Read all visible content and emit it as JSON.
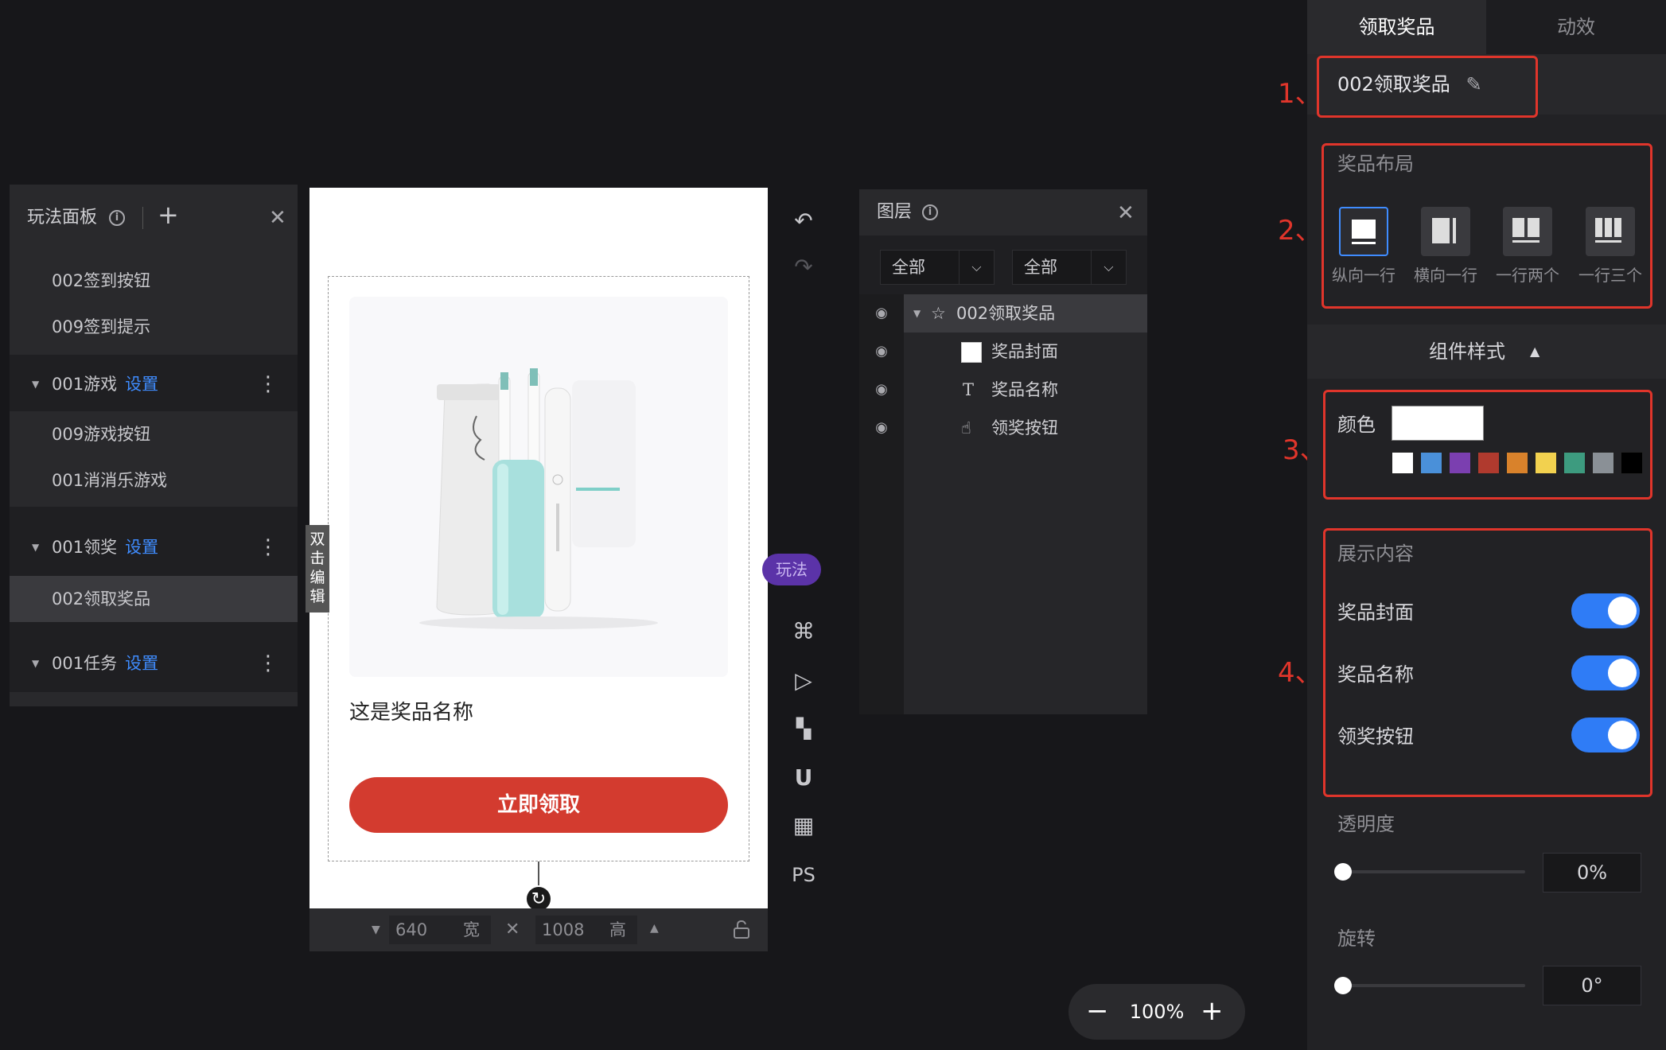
{
  "play_panel": {
    "title": "玩法面板",
    "info_icon": "ⓘ",
    "add_icon": "+",
    "close_icon": "✕",
    "items_top": [
      "002签到按钮",
      "009签到提示"
    ],
    "groups": [
      {
        "name": "001游戏",
        "link": "设置",
        "children": [
          "009游戏按钮",
          "001消消乐游戏"
        ]
      },
      {
        "name": "001领奖",
        "link": "设置",
        "children": [
          "002领取奖品"
        ]
      },
      {
        "name": "001任务",
        "link": "设置",
        "children": []
      }
    ]
  },
  "canvas": {
    "edit_tag": "双击编辑",
    "prize_name": "这是奖品名称",
    "claim_button": "立即领取",
    "width_value": "640",
    "width_label": "宽",
    "height_value": "1008",
    "height_label": "高",
    "times": "✕"
  },
  "tools": {
    "undo": "↶",
    "redo": "↷",
    "play_chip": "玩法",
    "command": "⌘",
    "play": "▷",
    "ruler": "▚",
    "magnet": "U",
    "grid": "▦",
    "ps": "PS"
  },
  "layers": {
    "title": "图层",
    "filter1": "全部",
    "filter2": "全部",
    "rows": [
      {
        "label": "002领取奖品",
        "icon": "star-outline-icon",
        "glyph": "☆",
        "indent": 0
      },
      {
        "label": "奖品封面",
        "icon": "image-thumb-icon",
        "glyph": "▫",
        "indent": 1
      },
      {
        "label": "奖品名称",
        "icon": "text-icon",
        "glyph": "T",
        "indent": 1
      },
      {
        "label": "领奖按钮",
        "icon": "hand-pointer-icon",
        "glyph": "☝",
        "indent": 1
      }
    ]
  },
  "zoom": {
    "minus": "−",
    "value": "100%",
    "plus": "+"
  },
  "right_panel": {
    "tabs": [
      "领取奖品",
      "动效"
    ],
    "component_name": "002领取奖品",
    "layout_title": "奖品布局",
    "layouts": [
      "纵向一行",
      "横向一行",
      "一行两个",
      "一行三个"
    ],
    "style_section": "组件样式",
    "style_caret": "▲",
    "color_label": "颜色",
    "swatches": [
      "#ffffff",
      "#4a90d9",
      "#7b3fb0",
      "#b03a2e",
      "#d9822b",
      "#f2d14f",
      "#3d9b7f",
      "#8a9096",
      "#000000"
    ],
    "selected_color": "#ffffff",
    "content_title": "展示内容",
    "toggles": [
      {
        "label": "奖品封面",
        "on": true
      },
      {
        "label": "奖品名称",
        "on": true
      },
      {
        "label": "领奖按钮",
        "on": true
      }
    ],
    "opacity_label": "透明度",
    "opacity_value": "0%",
    "rotate_label": "旋转",
    "rotate_value": "0°"
  },
  "annotations": [
    "1、",
    "2、",
    "3、",
    "4、"
  ],
  "colors": {
    "accent": "#3f8cff",
    "annotation": "#e0352b",
    "claim_button": "#d33b2f",
    "toggle_on": "#2f7cf6"
  }
}
